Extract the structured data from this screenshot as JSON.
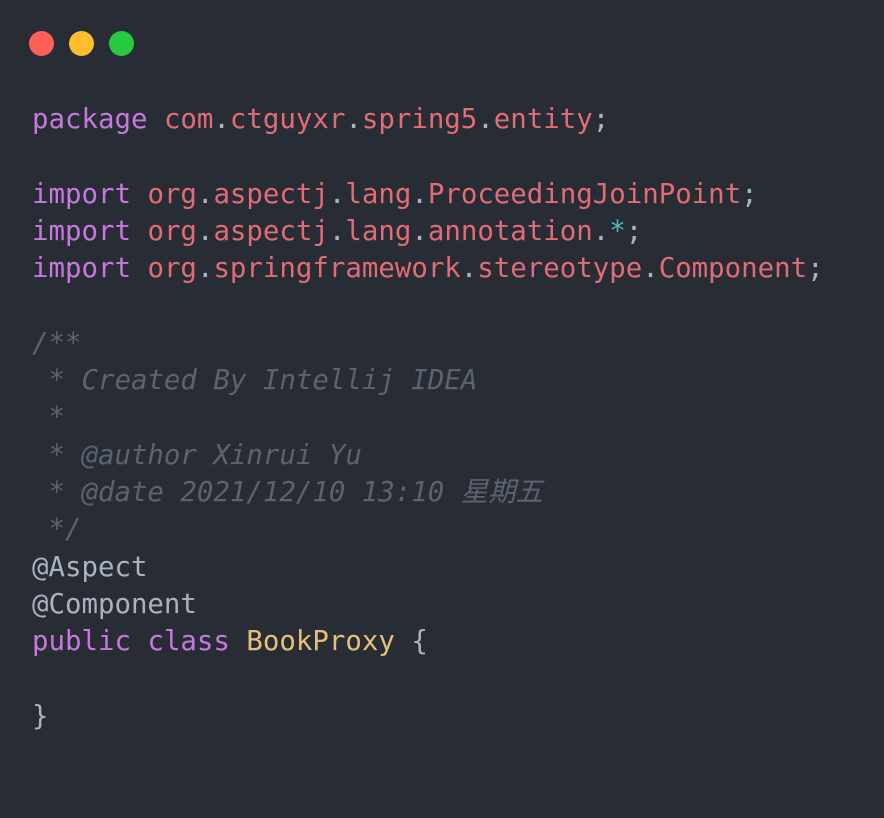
{
  "window": {
    "controls": [
      {
        "name": "close",
        "color": "#ff5f56"
      },
      {
        "name": "minimize",
        "color": "#ffbd2e"
      },
      {
        "name": "maximize",
        "color": "#27c93f"
      }
    ]
  },
  "code": {
    "lines": [
      [
        {
          "t": "package",
          "c": "kw"
        },
        {
          "t": " ",
          "c": "punc"
        },
        {
          "t": "com",
          "c": "pkg"
        },
        {
          "t": ".",
          "c": "punc"
        },
        {
          "t": "ctguyxr",
          "c": "pkg"
        },
        {
          "t": ".",
          "c": "punc"
        },
        {
          "t": "spring5",
          "c": "pkg"
        },
        {
          "t": ".",
          "c": "punc"
        },
        {
          "t": "entity",
          "c": "pkg"
        },
        {
          "t": ";",
          "c": "punc"
        }
      ],
      [],
      [
        {
          "t": "import",
          "c": "kw"
        },
        {
          "t": " ",
          "c": "punc"
        },
        {
          "t": "org",
          "c": "pkg"
        },
        {
          "t": ".",
          "c": "punc"
        },
        {
          "t": "aspectj",
          "c": "pkg"
        },
        {
          "t": ".",
          "c": "punc"
        },
        {
          "t": "lang",
          "c": "pkg"
        },
        {
          "t": ".",
          "c": "punc"
        },
        {
          "t": "ProceedingJoinPoint",
          "c": "pkg"
        },
        {
          "t": ";",
          "c": "punc"
        }
      ],
      [
        {
          "t": "import",
          "c": "kw"
        },
        {
          "t": " ",
          "c": "punc"
        },
        {
          "t": "org",
          "c": "pkg"
        },
        {
          "t": ".",
          "c": "punc"
        },
        {
          "t": "aspectj",
          "c": "pkg"
        },
        {
          "t": ".",
          "c": "punc"
        },
        {
          "t": "lang",
          "c": "pkg"
        },
        {
          "t": ".",
          "c": "punc"
        },
        {
          "t": "annotation",
          "c": "pkg"
        },
        {
          "t": ".",
          "c": "punc"
        },
        {
          "t": "*",
          "c": "op"
        },
        {
          "t": ";",
          "c": "punc"
        }
      ],
      [
        {
          "t": "import",
          "c": "kw"
        },
        {
          "t": " ",
          "c": "punc"
        },
        {
          "t": "org",
          "c": "pkg"
        },
        {
          "t": ".",
          "c": "punc"
        },
        {
          "t": "springframework",
          "c": "pkg"
        },
        {
          "t": ".",
          "c": "punc"
        },
        {
          "t": "stereotype",
          "c": "pkg"
        },
        {
          "t": ".",
          "c": "punc"
        },
        {
          "t": "Component",
          "c": "pkg"
        },
        {
          "t": ";",
          "c": "punc"
        }
      ],
      [],
      [
        {
          "t": "/**",
          "c": "cmt"
        }
      ],
      [
        {
          "t": " * Created By Intellij IDEA",
          "c": "cmt"
        }
      ],
      [
        {
          "t": " *",
          "c": "cmt"
        }
      ],
      [
        {
          "t": " * @author Xinrui Yu",
          "c": "cmt"
        }
      ],
      [
        {
          "t": " * @date 2021/12/10 13:10 星期五",
          "c": "cmt"
        }
      ],
      [
        {
          "t": " */",
          "c": "cmt"
        }
      ],
      [
        {
          "t": "@Aspect",
          "c": "ann"
        }
      ],
      [
        {
          "t": "@Component",
          "c": "ann"
        }
      ],
      [
        {
          "t": "public",
          "c": "kw"
        },
        {
          "t": " ",
          "c": "punc"
        },
        {
          "t": "class",
          "c": "kw"
        },
        {
          "t": " ",
          "c": "punc"
        },
        {
          "t": "BookProxy",
          "c": "cls"
        },
        {
          "t": " {",
          "c": "punc"
        }
      ],
      [],
      [
        {
          "t": "}",
          "c": "punc"
        }
      ]
    ]
  }
}
